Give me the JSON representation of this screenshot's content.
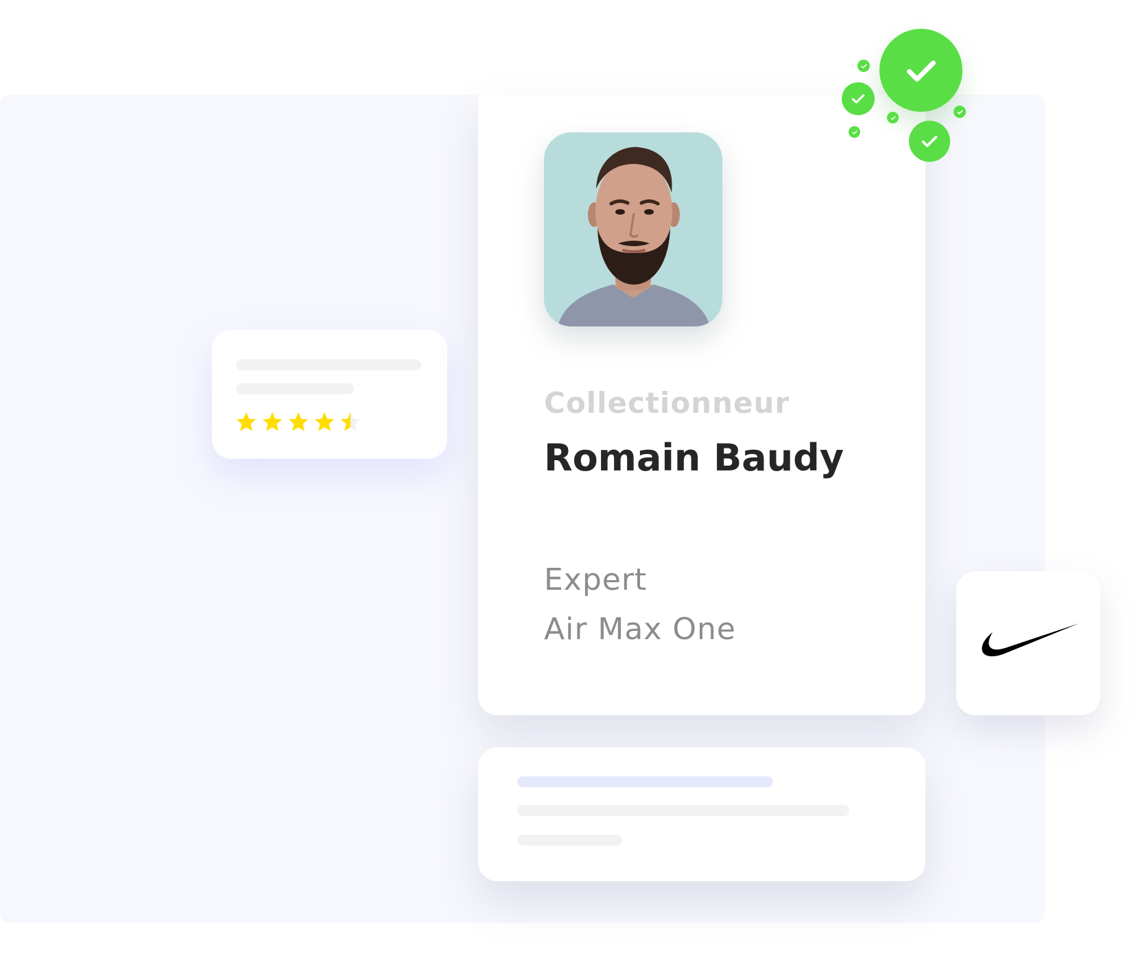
{
  "profile": {
    "role": "Collectionneur",
    "name": "Romain Baudy",
    "detail_line_1": "Expert",
    "detail_line_2": "Air Max One"
  },
  "rating": {
    "stars_value": 4.5,
    "stars_max": 5,
    "star_color": "#ffdd00"
  },
  "brand": {
    "logo": "nike-swoosh-icon"
  },
  "colors": {
    "accent_green": "#5ade45",
    "background": "#f7f8fd",
    "skeleton_accent": "#e6e8fd",
    "skeleton": "#f2f2f2"
  }
}
